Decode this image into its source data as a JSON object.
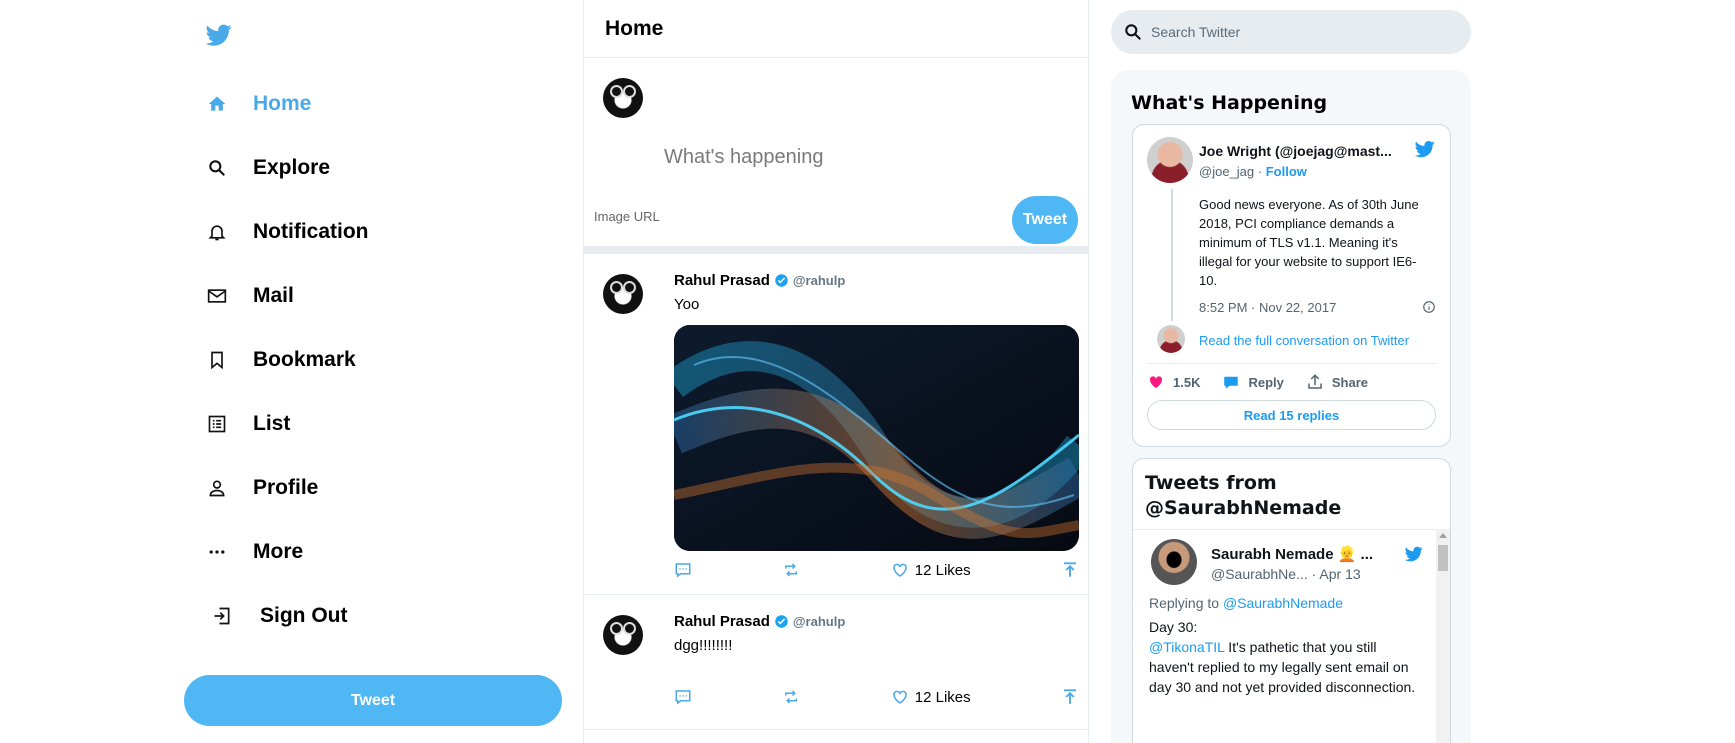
{
  "sidebar": {
    "nav": [
      {
        "label": "Home",
        "icon": "home-icon",
        "active": true
      },
      {
        "label": "Explore",
        "icon": "search-icon"
      },
      {
        "label": "Notification",
        "icon": "bell-icon"
      },
      {
        "label": "Mail",
        "icon": "mail-icon"
      },
      {
        "label": "Bookmark",
        "icon": "bookmark-icon"
      },
      {
        "label": "List",
        "icon": "list-icon"
      },
      {
        "label": "Profile",
        "icon": "person-icon"
      },
      {
        "label": "More",
        "icon": "more-icon"
      }
    ],
    "sign_out_label": "Sign Out",
    "tweet_button": "Tweet"
  },
  "feed": {
    "title": "Home",
    "composer": {
      "placeholder": "What's happening",
      "image_url_placeholder": "Image URL",
      "tweet_button": "Tweet"
    },
    "posts": [
      {
        "name": "Rahul Prasad",
        "handle": "@rahulp",
        "text": "Yoo",
        "has_image": true,
        "likes": "12 Likes"
      },
      {
        "name": "Rahul Prasad",
        "handle": "@rahulp",
        "text": "dgg!!!!!!!!",
        "has_image": false,
        "likes": "12 Likes"
      }
    ]
  },
  "right": {
    "search_placeholder": "Search Twitter",
    "whats_happening": "What's Happening",
    "embed": {
      "name": "Joe Wright (@joejag@mast...",
      "handle": "@joe_jag",
      "separator": "·",
      "follow": "Follow",
      "text": "Good news everyone. As of 30th June 2018, PCI compliance demands a minimum of TLS v1.1. Meaning it's illegal for your website to support IE6-10.",
      "time": "8:52 PM · Nov 22, 2017",
      "read_conversation": "Read the full conversation on Twitter",
      "likes": "1.5K",
      "reply": "Reply",
      "share": "Share",
      "read_replies": "Read 15 replies"
    },
    "timeline": {
      "title_line1": "Tweets from",
      "title_line2": "@SaurabhNemade",
      "name": "Saurabh Nemade 👱 ...",
      "handle": "@SaurabhNe...",
      "date": "· Apr 13",
      "replying_prefix": "Replying to ",
      "replying_to": "@SaurabhNemade",
      "day": "Day 30:",
      "mention": "@TikonaTIL",
      "text": " It's pathetic that you still haven't replied to my legally sent email on day 30 and not yet provided disconnection."
    }
  },
  "colors": {
    "brand": "#1da1f2",
    "button": "#50b7f5",
    "active_nav": "#4aa9e9",
    "like": "#f91880"
  }
}
